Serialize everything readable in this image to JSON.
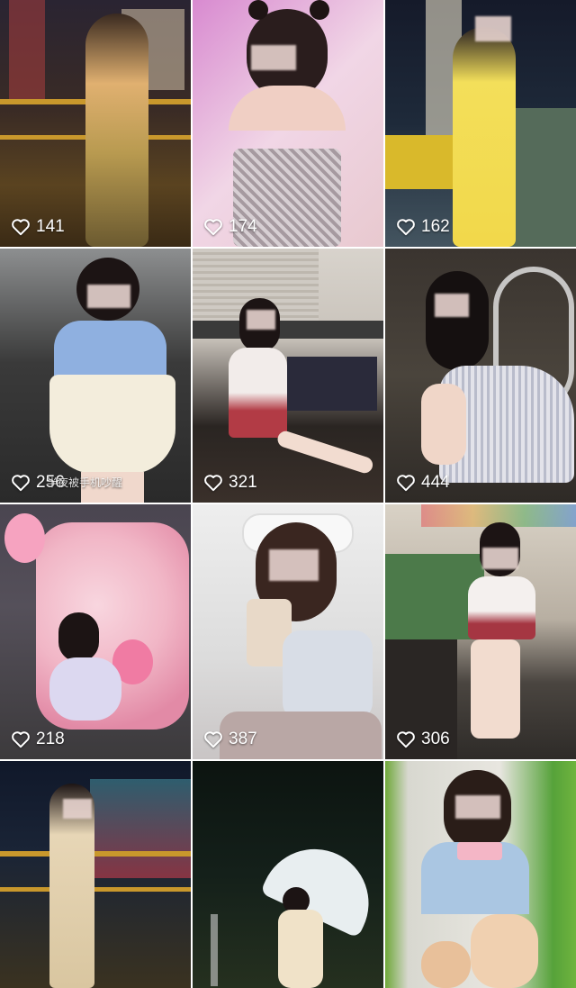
{
  "tiles": [
    {
      "likes": "141"
    },
    {
      "likes": "174"
    },
    {
      "likes": "162"
    },
    {
      "likes": "256",
      "overlay": "半夜被手机吵醒"
    },
    {
      "likes": "321"
    },
    {
      "likes": "444"
    },
    {
      "likes": "218"
    },
    {
      "likes": "387"
    },
    {
      "likes": "306"
    },
    {
      "likes": ""
    },
    {
      "likes": ""
    },
    {
      "likes": ""
    }
  ],
  "icons": {
    "like": "heart-outline-icon"
  },
  "colors": {
    "text": "#ffffff",
    "background": "#ffffff"
  }
}
